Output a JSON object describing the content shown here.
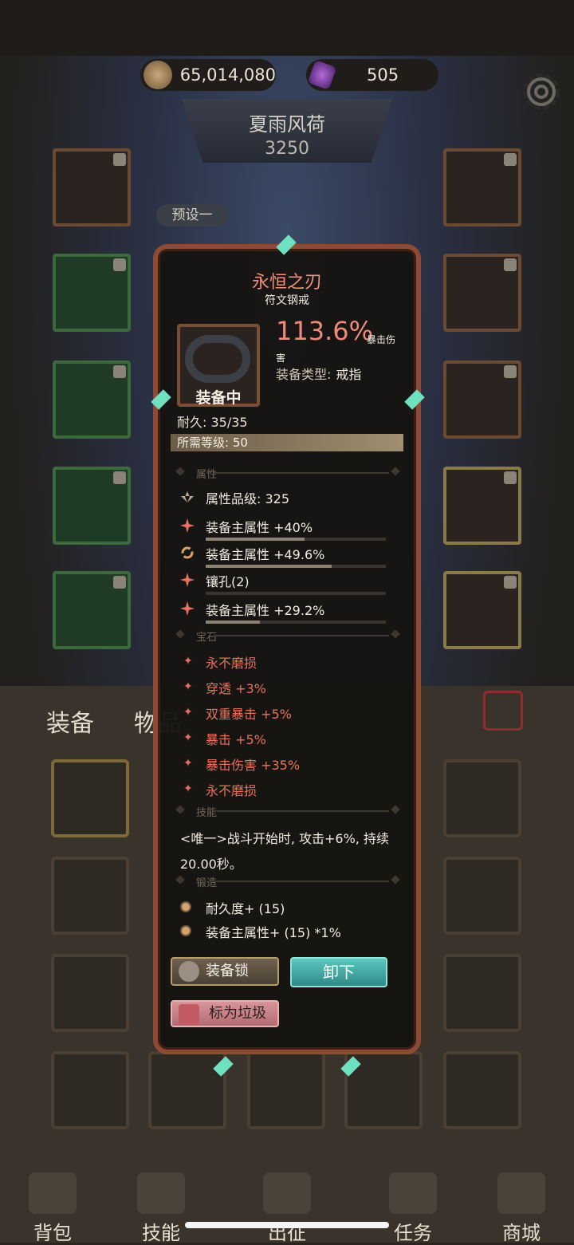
{
  "resources": {
    "gold": "65,014,080",
    "gems": "505"
  },
  "hero": {
    "name": "夏雨风荷",
    "power": "3250",
    "preset": "预设一"
  },
  "inventory_tabs": [
    "装备",
    "物品"
  ],
  "item": {
    "name": "永恒之刃",
    "subtitle": "符文钢戒",
    "equipped_label": "装备中",
    "main_value": "113.6%",
    "main_label_a": "暴击伤",
    "main_label_b": "害",
    "type_label": "装备类型:",
    "type_value": "戒指",
    "durability": "耐久: 35/35",
    "required_level": "所需等级: 50",
    "sections": {
      "attributes": "属性",
      "gems": "宝石",
      "skill": "技能",
      "forge": "锻造"
    },
    "attribute_tier": "属性品级: 325",
    "attributes": [
      {
        "text": "装备主属性 +40%",
        "fill": 0.55
      },
      {
        "text": "装备主属性 +49.6%",
        "fill": 0.7
      },
      {
        "text": "镶孔(2)",
        "fill": 0.0
      },
      {
        "text": "装备主属性 +29.2%",
        "fill": 0.3
      }
    ],
    "gems": [
      "永不磨损",
      "穿透 +3%",
      "双重暴击 +5%",
      "暴击 +5%",
      "暴击伤害 +35%",
      "永不磨损"
    ],
    "skill_text": "<唯一>战斗开始时, 攻击+6%, 持续20.00秒。",
    "forge": [
      "耐久度+ (15)",
      "装备主属性+ (15) *1%"
    ],
    "buttons": {
      "lock": "装备锁",
      "unequip": "卸下",
      "junk": "标为垃圾"
    }
  },
  "nav": [
    "背包",
    "技能",
    "出征",
    "任务",
    "商城"
  ]
}
